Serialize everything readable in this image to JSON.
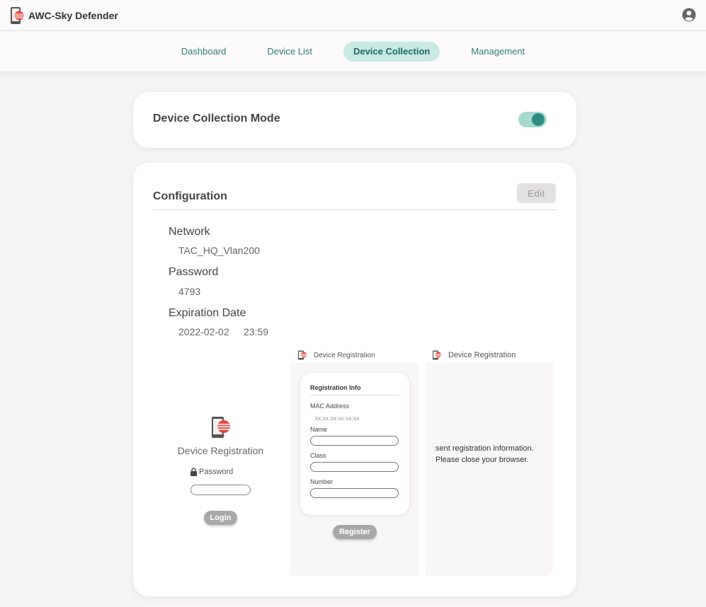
{
  "app": {
    "title": "AWC-Sky Defender"
  },
  "nav": {
    "tabs": [
      {
        "label": "Dashboard"
      },
      {
        "label": "Device List"
      },
      {
        "label": "Device Collection",
        "active": true
      },
      {
        "label": "Management"
      }
    ]
  },
  "mode": {
    "title": "Device Collection Mode",
    "enabled": true
  },
  "config": {
    "title": "Configuration",
    "edit_label": "Edit",
    "network_label": "Network",
    "network_value": "TAC_HQ_Vlan200",
    "password_label": "Password",
    "password_value": "4793",
    "expiration_label": "Expiration Date",
    "expiration_date": "2022-02-02",
    "expiration_time": "23:59"
  },
  "preview": {
    "login": {
      "title": "Device Registration",
      "password_label": "Password",
      "login_label": "Login"
    },
    "register": {
      "header": "Device Registration",
      "card_title": "Registration Info",
      "mac_label": "MAC Address",
      "mac_value": "xx:xx:xx:xx:xx:xx",
      "name_label": "Name",
      "class_label": "Class",
      "number_label": "Number",
      "register_label": "Register"
    },
    "done": {
      "header": "Device Registration",
      "line1": "sent registration information.",
      "line2": "Please close your browser."
    }
  },
  "colors": {
    "accent": "#2e8c80",
    "tab_active_bg": "#c9e9e3",
    "logo_red": "#e8453c"
  },
  "icons": {
    "logo": "phone-shield-icon",
    "user": "user-circle-icon",
    "lock": "lock-icon"
  }
}
